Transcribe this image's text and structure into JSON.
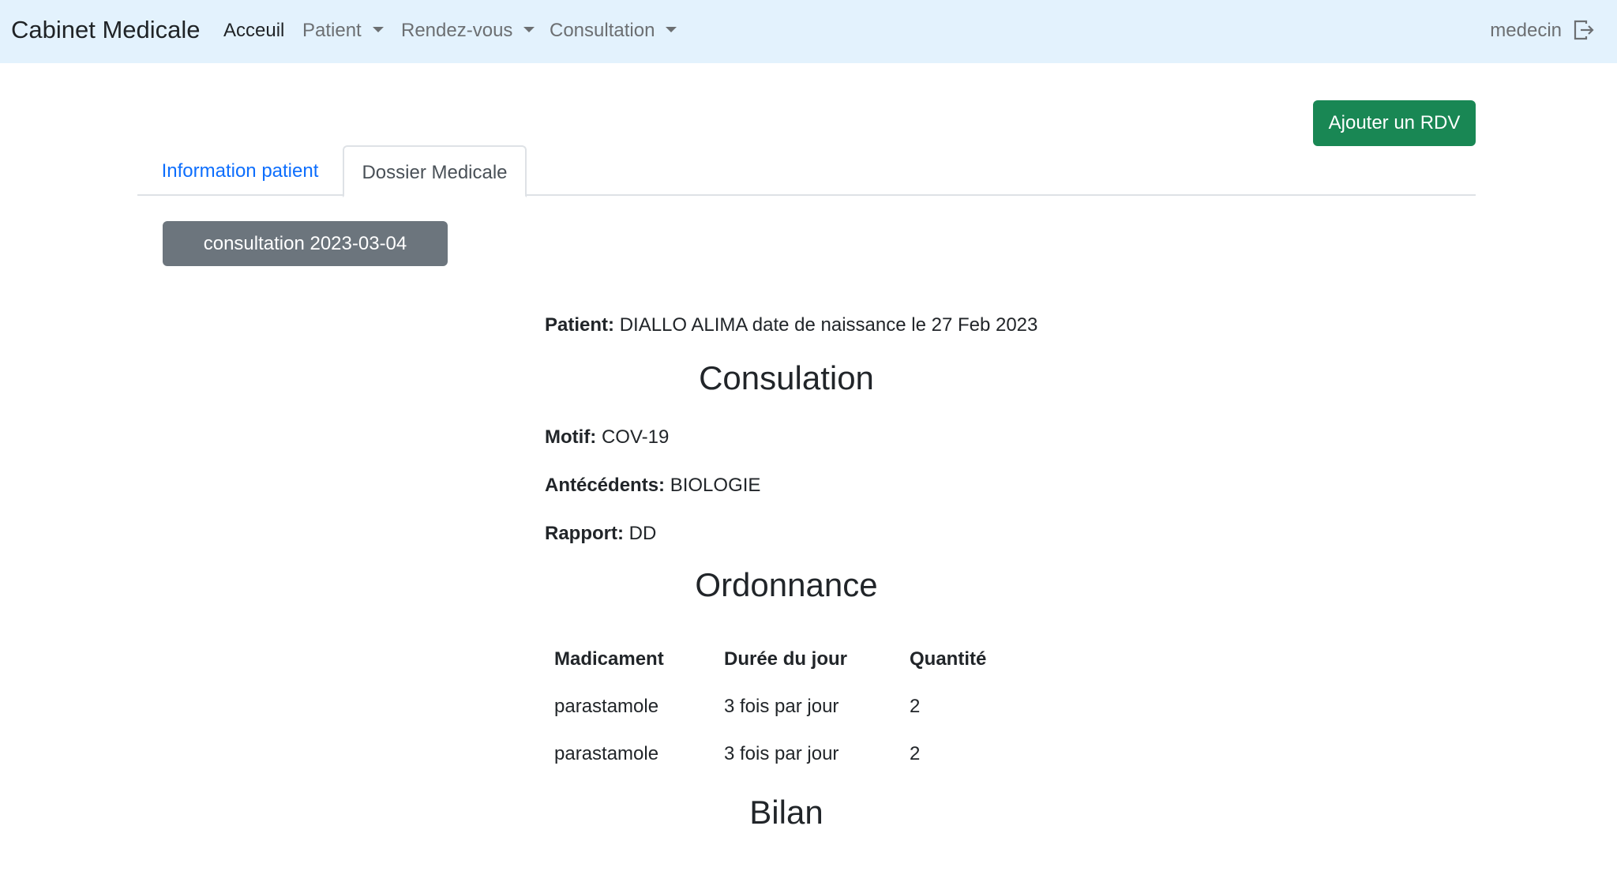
{
  "navbar": {
    "brand": "Cabinet Medicale",
    "links": [
      {
        "label": "Acceuil"
      },
      {
        "label": "Patient"
      },
      {
        "label": "Rendez-vous"
      },
      {
        "label": "Consultation"
      }
    ],
    "user": "medecin",
    "logout_icon": "logout-icon"
  },
  "actions": {
    "add_rdv": "Ajouter un RDV"
  },
  "tabs": [
    {
      "label": "Information patient",
      "active": false
    },
    {
      "label": "Dossier Medicale",
      "active": true
    }
  ],
  "consultation_button": "consultation 2023-03-04",
  "patient": {
    "label": "Patient:",
    "value": "DIALLO ALIMA date de naissance le 27 Feb 2023"
  },
  "consultation": {
    "title": "Consulation",
    "motif_label": "Motif:",
    "motif": "COV-19",
    "antecedents_label": "Antécédents:",
    "antecedents": "BIOLOGIE",
    "rapport_label": "Rapport:",
    "rapport": "DD"
  },
  "ordonnance": {
    "title": "Ordonnance",
    "headers": [
      "Madicament",
      "Durée du jour",
      "Quantité"
    ],
    "rows": [
      [
        "parastamole",
        "3 fois par jour",
        "2"
      ],
      [
        "parastamole",
        "3 fois par jour",
        "2"
      ]
    ]
  },
  "bilan": {
    "title": "Bilan"
  },
  "colors": {
    "navbar_bg": "#e3f2fd",
    "success": "#198754",
    "secondary": "#6c757d",
    "link": "#0d6efd"
  }
}
